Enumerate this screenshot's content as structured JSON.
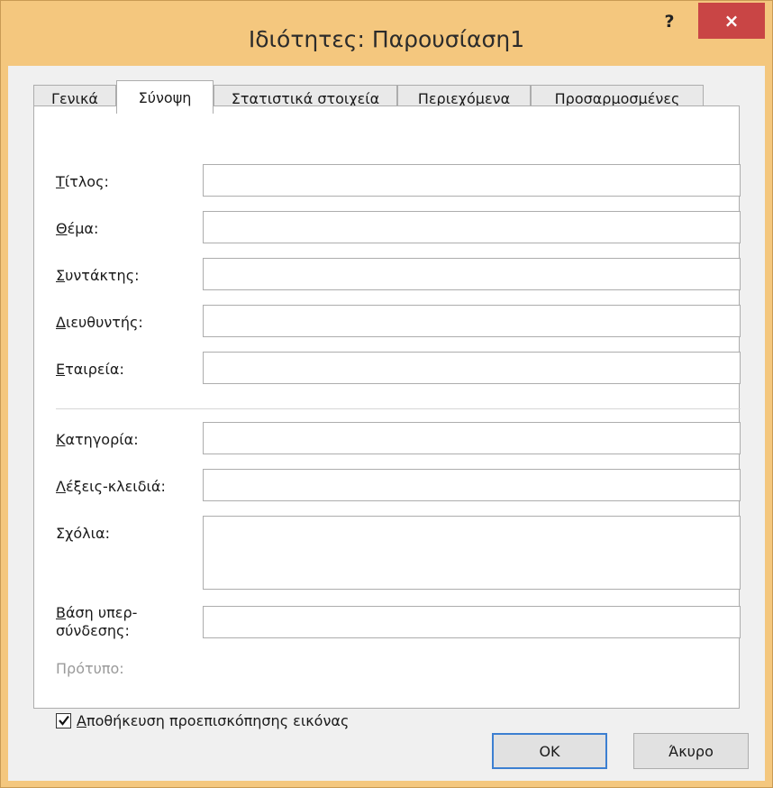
{
  "window": {
    "title": "Ιδιότητες: Παρουσίαση1",
    "help_label": "?",
    "close_label": "×"
  },
  "tabs": [
    {
      "label": "Γενικά"
    },
    {
      "label": "Σύνοψη"
    },
    {
      "label": "Στατιστικά στοιχεία"
    },
    {
      "label": "Περιεχόμενα"
    },
    {
      "label": "Προσαρμοσμένες"
    }
  ],
  "fields": {
    "title": {
      "accel": "Τ",
      "rest": "ίτλος:",
      "value": ""
    },
    "subject": {
      "accel": "Θ",
      "rest": "έμα:",
      "value": ""
    },
    "author": {
      "accel": "Σ",
      "rest": "υντάκτης:",
      "value": ""
    },
    "manager": {
      "accel": "Δ",
      "rest": "ιευθυντής:",
      "value": ""
    },
    "company": {
      "accel": "Ε",
      "rest": "ταιρεία:",
      "value": ""
    },
    "category": {
      "accel": "Κ",
      "rest": "ατηγορία:",
      "value": ""
    },
    "keywords": {
      "accel": "Λ",
      "rest": "έξεις-κλειδιά:",
      "value": ""
    },
    "comments": {
      "pre": "Σ",
      "accel": "χ",
      "rest": "όλια:",
      "value": ""
    },
    "hyperlink_base": {
      "accel": "Β",
      "rest": "άση υπερ-",
      "line2": "σύνδεσης:",
      "value": ""
    },
    "template": {
      "label": "Πρότυπο:"
    }
  },
  "save_preview": {
    "checked": true,
    "accel": "Α",
    "rest": "ποθήκευση προεπισκόπησης εικόνας"
  },
  "buttons": {
    "ok": "OK",
    "cancel": "Άκυρο"
  },
  "colors": {
    "frame": "#f4c77e",
    "close": "#c94545",
    "default_button_border": "#3c7fd1"
  }
}
